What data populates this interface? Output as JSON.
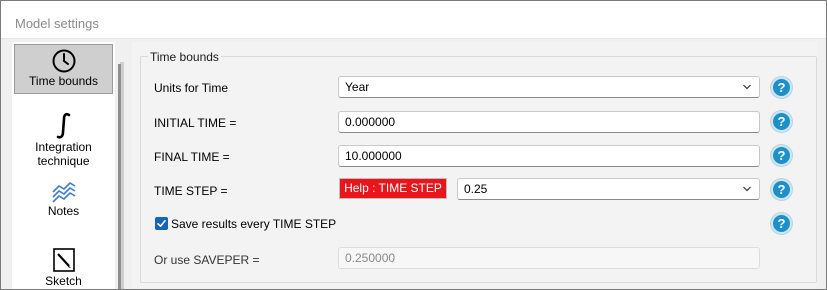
{
  "window": {
    "title": "Model settings"
  },
  "sidebar": {
    "items": [
      {
        "label": "Time bounds",
        "icon": "clock-icon",
        "active": true
      },
      {
        "label_line1": "Integration",
        "label_line2": "technique",
        "icon": "integral-icon"
      },
      {
        "label": "Notes",
        "icon": "notes-chart-icon"
      },
      {
        "label": "Sketch",
        "icon": "sketch-icon"
      }
    ]
  },
  "group": {
    "title": "Time bounds"
  },
  "fields": {
    "units": {
      "label": "Units for Time",
      "value": "Year"
    },
    "initial_time": {
      "label": "INITIAL TIME =",
      "value": "0.000000"
    },
    "final_time": {
      "label": "FINAL TIME =",
      "value": "10.000000"
    },
    "time_step": {
      "label": "TIME STEP =",
      "help_button": "Help : TIME STEP",
      "value": "0.25"
    },
    "save_results": {
      "label": "Save results every TIME STEP",
      "checked": true
    },
    "saveper": {
      "label": "Or use SAVEPER =",
      "value": "0.250000"
    }
  },
  "help": {
    "glyph": "?"
  },
  "colors": {
    "help_blue": "#1e90c8",
    "help_red": "#e8161b",
    "checkbox_blue": "#1766b5"
  }
}
